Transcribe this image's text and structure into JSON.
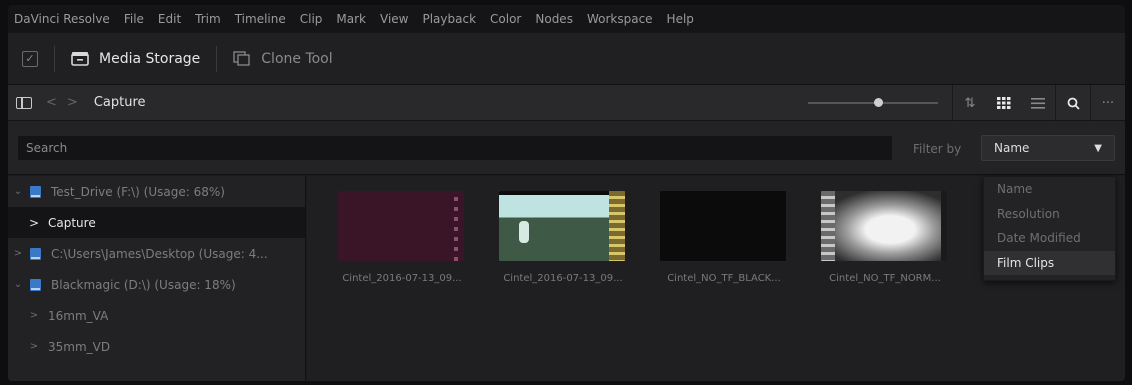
{
  "menubar": {
    "items": [
      "DaVinci Resolve",
      "File",
      "Edit",
      "Trim",
      "Timeline",
      "Clip",
      "Mark",
      "View",
      "Playback",
      "Color",
      "Nodes",
      "Workspace",
      "Help"
    ]
  },
  "toolbar": {
    "media_storage": "Media Storage",
    "clone_tool": "Clone Tool"
  },
  "navbar": {
    "breadcrumb": "Capture"
  },
  "search": {
    "placeholder": "Search",
    "filter_label": "Filter by",
    "filter_value": "Name",
    "filter_options": [
      "Name",
      "Resolution",
      "Date Modified",
      "Film Clips"
    ],
    "selected_option": "Film Clips"
  },
  "tree": [
    {
      "label": "Test_Drive (F:\\) (Usage: 68%)",
      "type": "drive",
      "expanded": true
    },
    {
      "label": "Capture",
      "type": "folder",
      "selected": true
    },
    {
      "label": "C:\\Users\\James\\Desktop (Usage: 4...",
      "type": "drive",
      "expanded": false
    },
    {
      "label": "Blackmagic (D:\\) (Usage: 18%)",
      "type": "drive",
      "expanded": true
    },
    {
      "label": "16mm_VA",
      "type": "folder"
    },
    {
      "label": "35mm_VD",
      "type": "folder"
    }
  ],
  "clips": [
    {
      "name": "Cintel_2016-07-13_09..."
    },
    {
      "name": "Cintel_2016-07-13_09..."
    },
    {
      "name": "Cintel_NO_TF_BLACK..."
    },
    {
      "name": "Cintel_NO_TF_NORM..."
    }
  ],
  "colors": {
    "accent_drive": "#3a78c8",
    "background": "#1c1c1e"
  }
}
